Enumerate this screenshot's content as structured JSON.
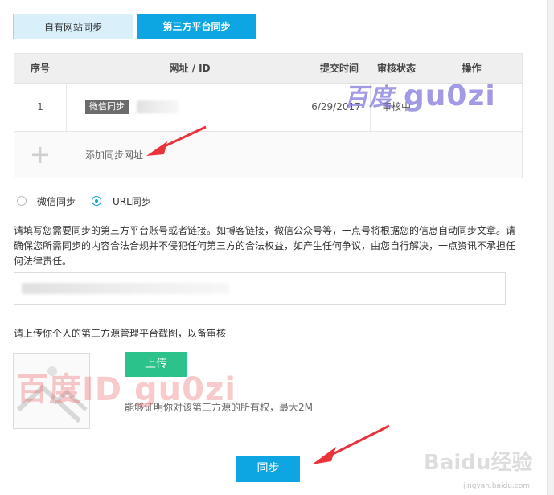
{
  "tabs": {
    "own_site": "自有网站同步",
    "third_party": "第三方平台同步"
  },
  "table": {
    "headers": {
      "index": "序号",
      "url_id": "网址 / ID",
      "submit_time": "提交时间",
      "review_status": "审核状态",
      "action": "操作"
    },
    "rows": [
      {
        "index": "1",
        "type_badge": "微信同步",
        "submit_time": "6/29/2017",
        "status": "审核中"
      }
    ],
    "add_row": {
      "plus": "+",
      "label": "添加同步网址"
    }
  },
  "sync_type": {
    "options": [
      "微信同步",
      "URL同步"
    ],
    "selected": "URL同步"
  },
  "instructions": "请填写您需要同步的第三方平台账号或者链接。如博客链接，微信公众号等，一点号将根据您的信息自动同步文章。请确保您所需同步的内容合法合规并不侵犯任何第三方的合法权益，如产生任何争议，由您自行解决，一点资讯不承担任何法律责任。",
  "upload": {
    "prompt": "请上传你个人的第三方源管理平台截图，以备审核",
    "button": "上传",
    "hint": "能够证明你对该第三方源的所有权，最大2M"
  },
  "submit_button": "同步",
  "watermarks": {
    "top_cn": "百度",
    "top_id": "gu0zi",
    "middle": "百度ID gu0zi",
    "baidu_logo": "Baidu经验",
    "baidu_url": "jingyan.baidu.com"
  },
  "colors": {
    "accent": "#0ea5e3",
    "upload_green": "#2bc28b",
    "tab_light": "#d9f0fb",
    "arrow_red": "#e8333b"
  }
}
